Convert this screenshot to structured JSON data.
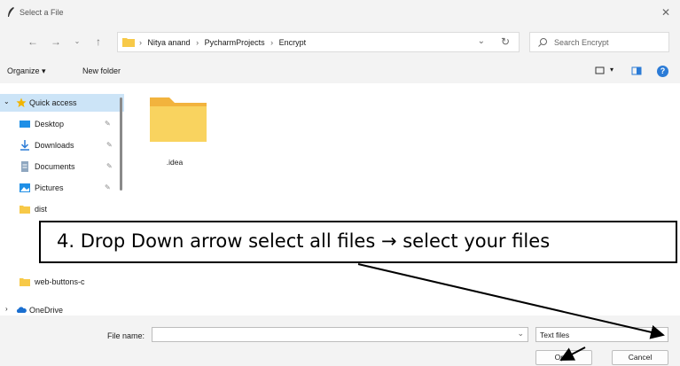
{
  "window": {
    "title": "Select a File"
  },
  "address": {
    "crumbs": [
      "Nitya anand",
      "PycharmProjects",
      "Encrypt"
    ],
    "separator": "›"
  },
  "search": {
    "placeholder": "Search Encrypt"
  },
  "toolbar": {
    "organize_label": "Organize ▾",
    "new_folder_label": "New folder"
  },
  "sidebar": {
    "items": [
      {
        "label": "Quick access",
        "icon": "star-icon"
      },
      {
        "label": "Desktop",
        "icon": "desktop-icon",
        "pinned": true
      },
      {
        "label": "Downloads",
        "icon": "download-icon",
        "pinned": true
      },
      {
        "label": "Documents",
        "icon": "document-icon",
        "pinned": true
      },
      {
        "label": "Pictures",
        "icon": "pictures-icon",
        "pinned": true
      },
      {
        "label": "dist",
        "icon": "folder-icon"
      },
      {
        "label": "web-buttons-c",
        "icon": "folder-icon"
      },
      {
        "label": "OneDrive",
        "icon": "cloud-icon"
      }
    ],
    "pin_glyph": "📌"
  },
  "files": [
    {
      "name": ".idea",
      "type": "folder"
    }
  ],
  "annotation": {
    "text": "4. Drop Down arrow select all files → select your files"
  },
  "footer": {
    "file_name_label": "File name:",
    "file_name_value": "",
    "filter_value": "Text files",
    "open_label": "Open",
    "cancel_label": "Cancel"
  },
  "colors": {
    "accent": "#2b7bd6",
    "folder": "#f7c948",
    "selection": "#cce4f7"
  }
}
